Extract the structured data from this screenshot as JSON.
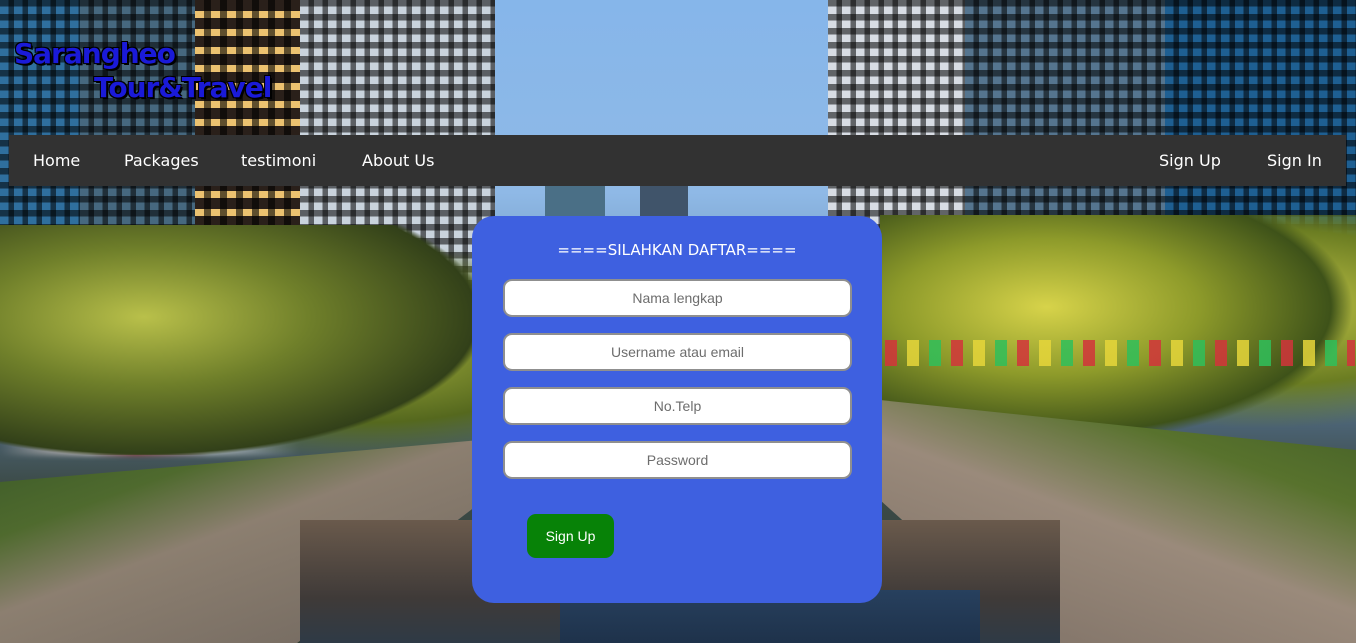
{
  "brand": {
    "line1": "Sarangheo",
    "line2": "Tour&Travel"
  },
  "nav": {
    "left": [
      "Home",
      "Packages",
      "testimoni",
      "About Us"
    ],
    "right": [
      "Sign Up",
      "Sign In"
    ]
  },
  "form": {
    "title": "====SILAHKAN DAFTAR====",
    "fields": [
      {
        "placeholder": "Nama lengkap",
        "value": ""
      },
      {
        "placeholder": "Username atau email",
        "value": ""
      },
      {
        "placeholder": "No.Telp",
        "value": ""
      },
      {
        "placeholder": "Password",
        "value": ""
      }
    ],
    "submit_label": "Sign Up"
  },
  "colors": {
    "navbar": "#323232",
    "card": "#3e60e0",
    "button": "#078207",
    "brand_text": "#1a1ad8"
  }
}
